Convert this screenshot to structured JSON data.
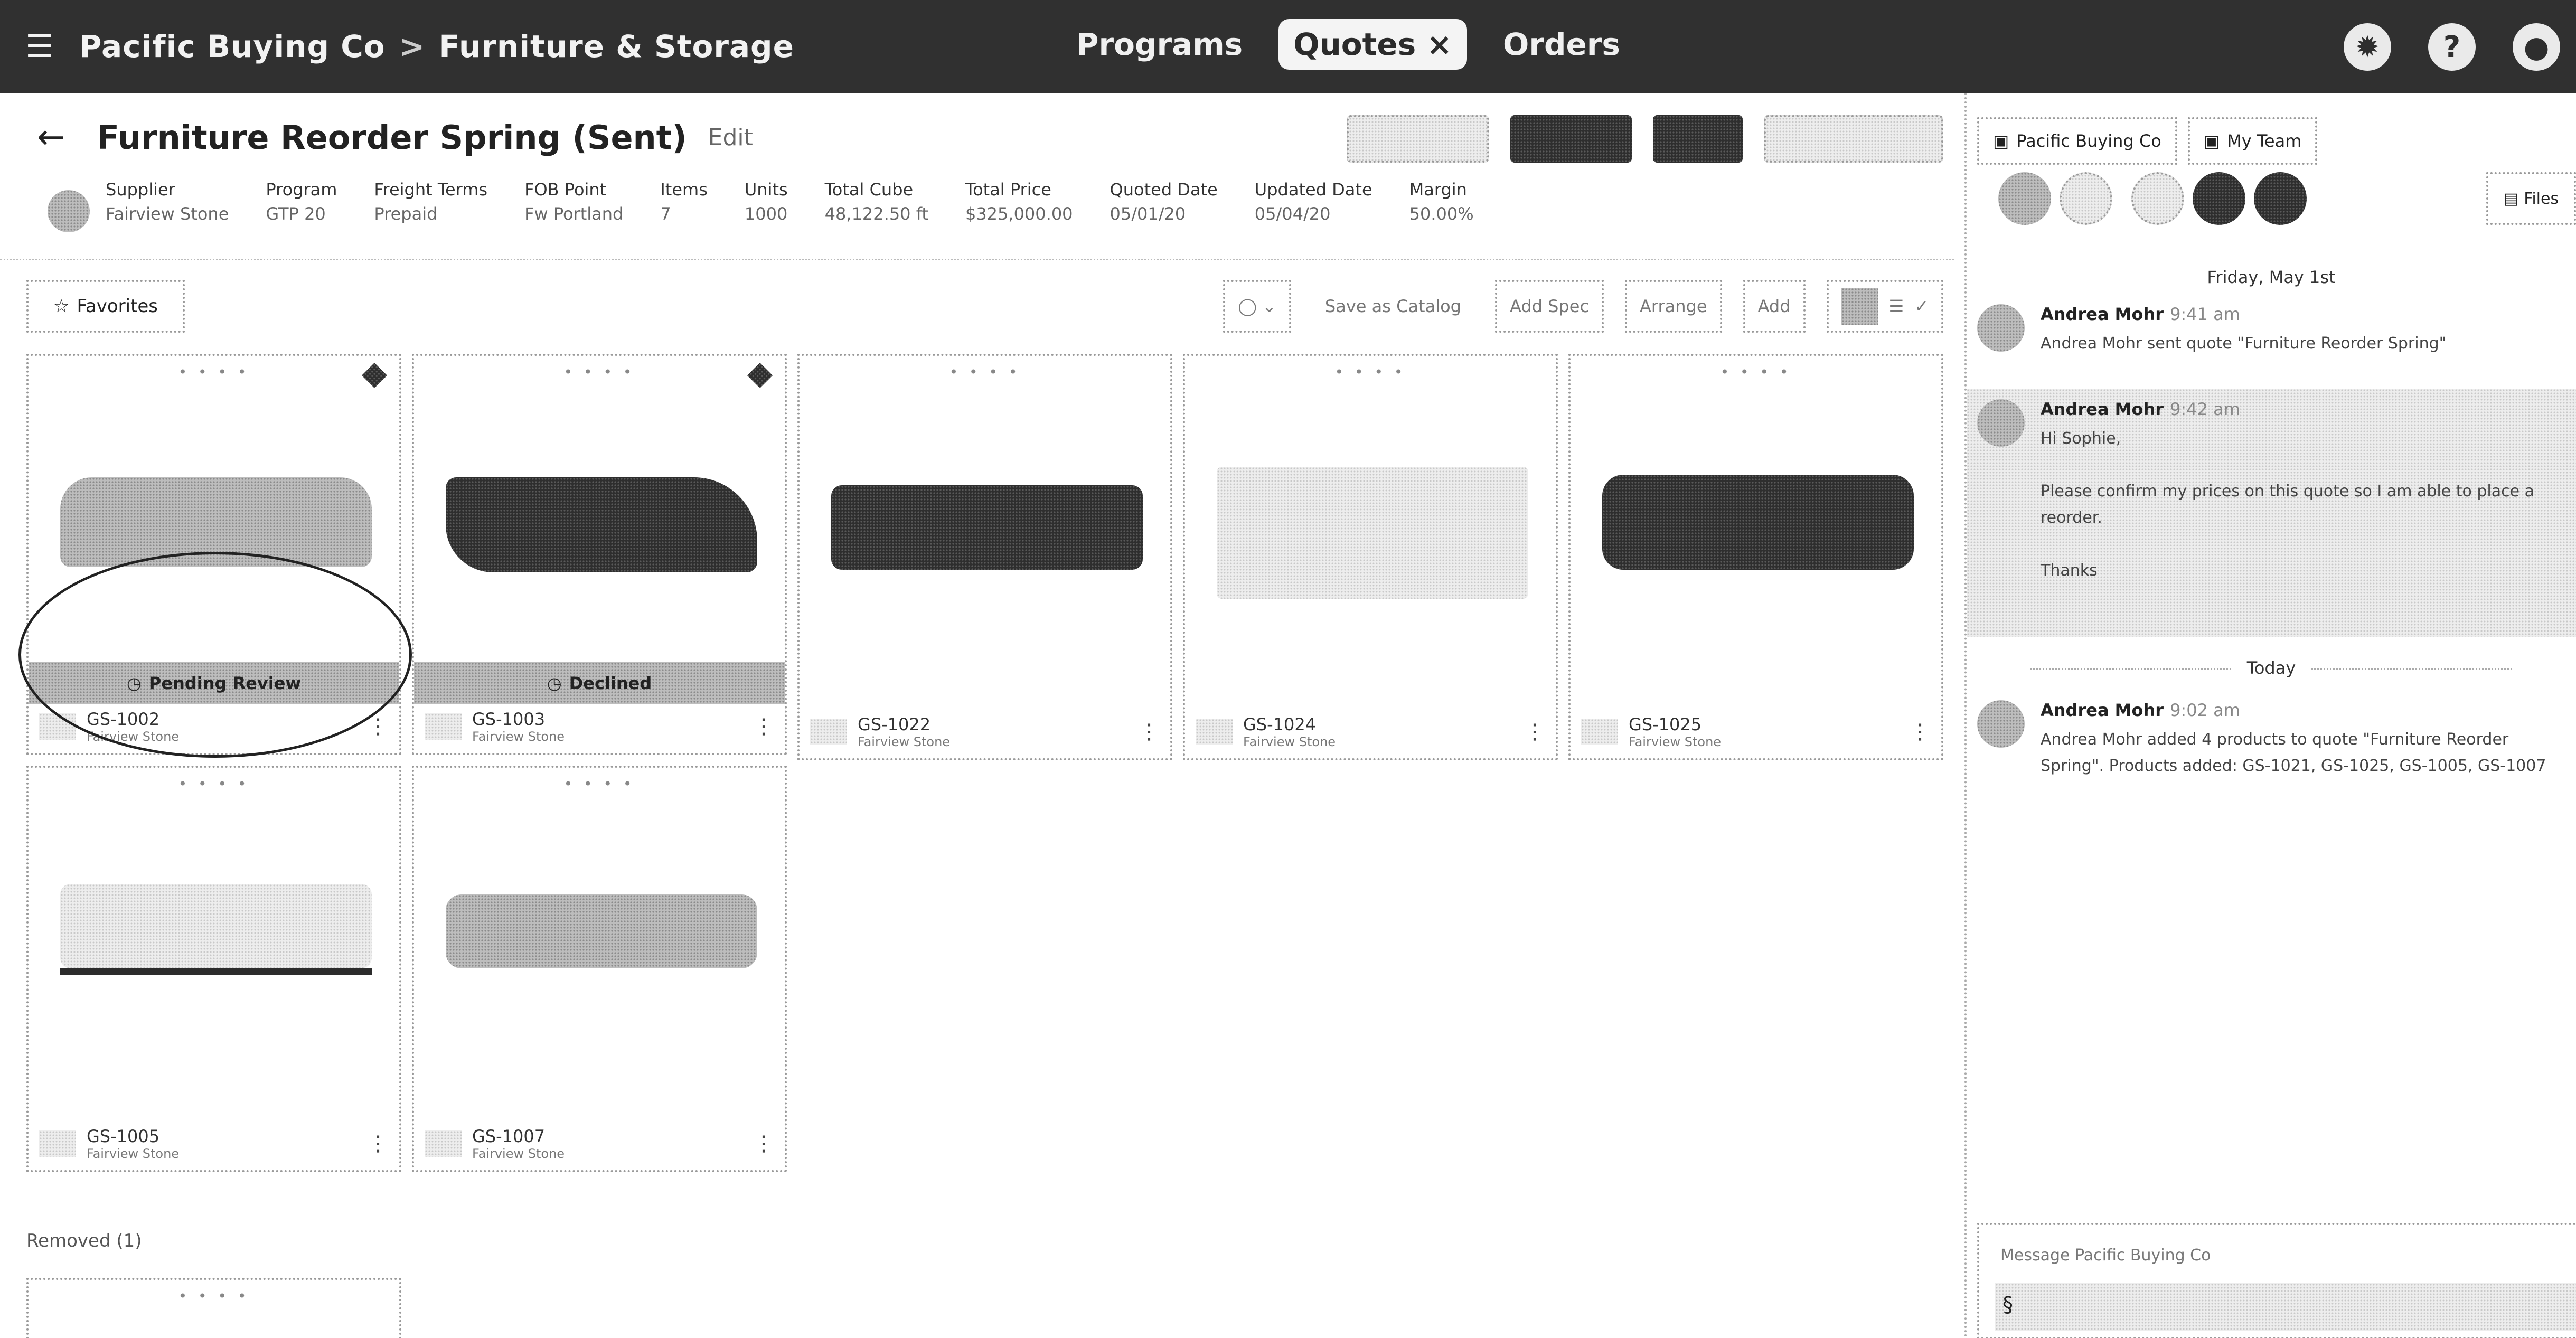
{
  "topbar": {
    "org": "Pacific Buying Co",
    "category": "Furniture & Storage",
    "separator": ">",
    "nav": [
      {
        "label": "Programs",
        "active": false
      },
      {
        "label": "Quotes",
        "badge": "×",
        "active": true
      },
      {
        "label": "Orders",
        "active": false
      }
    ],
    "help_icon": "?"
  },
  "quote": {
    "title": "Furniture Reorder Spring (Sent)",
    "edit_label": "Edit"
  },
  "stats": [
    {
      "key": "Supplier",
      "value": "Fairview Stone"
    },
    {
      "key": "Program",
      "value": "GTP 20"
    },
    {
      "key": "Freight Terms",
      "value": "Prepaid"
    },
    {
      "key": "FOB Point",
      "value": "Fw Portland"
    },
    {
      "key": "Items",
      "value": "7"
    },
    {
      "key": "Units",
      "value": "1000"
    },
    {
      "key": "Total Cube",
      "value": "48,122.50 ft"
    },
    {
      "key": "Total Price",
      "value": "$325,000.00"
    },
    {
      "key": "Quoted Date",
      "value": "05/01/20"
    },
    {
      "key": "Updated Date",
      "value": "05/04/20"
    },
    {
      "key": "Margin",
      "value": "50.00%"
    }
  ],
  "toolbar": {
    "favorites": "Favorites",
    "buttons": [
      "Save as Catalog",
      "Add Spec",
      "Arrange",
      "Add"
    ]
  },
  "products": [
    {
      "code": "GS-1002",
      "supplier": "Fairview Stone",
      "banner": "Pending Review",
      "pinned": true
    },
    {
      "code": "GS-1003",
      "supplier": "Fairview Stone",
      "banner": "Declined",
      "pinned": true
    },
    {
      "code": "GS-1022",
      "supplier": "Fairview Stone",
      "banner": "",
      "pinned": false
    },
    {
      "code": "GS-1024",
      "supplier": "Fairview Stone",
      "banner": "",
      "pinned": false
    },
    {
      "code": "GS-1025",
      "supplier": "Fairview Stone",
      "banner": "",
      "pinned": false
    },
    {
      "code": "GS-1005",
      "supplier": "Fairview Stone",
      "banner": "",
      "pinned": false
    },
    {
      "code": "GS-1007",
      "supplier": "Fairview Stone",
      "banner": "",
      "pinned": false
    }
  ],
  "removed": {
    "label": "Removed (1)"
  },
  "panel": {
    "tabs": [
      "Pacific Buying Co",
      "My Team"
    ],
    "files_label": "Files",
    "date1": "Friday, May 1st",
    "date2": "Today",
    "messages": [
      {
        "name": "Andrea Mohr",
        "time": "9:41 am",
        "text": "Andrea Mohr sent quote \"Furniture Reorder Spring\""
      },
      {
        "name": "Andrea Mohr",
        "time": "9:42 am",
        "text": "Hi Sophie,\n\nPlease confirm my prices on this quote so I am able to place a reorder.\n\nThanks"
      },
      {
        "name": "Andrea Mohr",
        "time": "9:02 am",
        "text": "Andrea Mohr added 4 products to quote \"Furniture Reorder Spring\". Products added: GS-1021, GS-1025, GS-1005, GS-1007"
      }
    ],
    "composer_placeholder": "Message Pacific Buying Co"
  }
}
